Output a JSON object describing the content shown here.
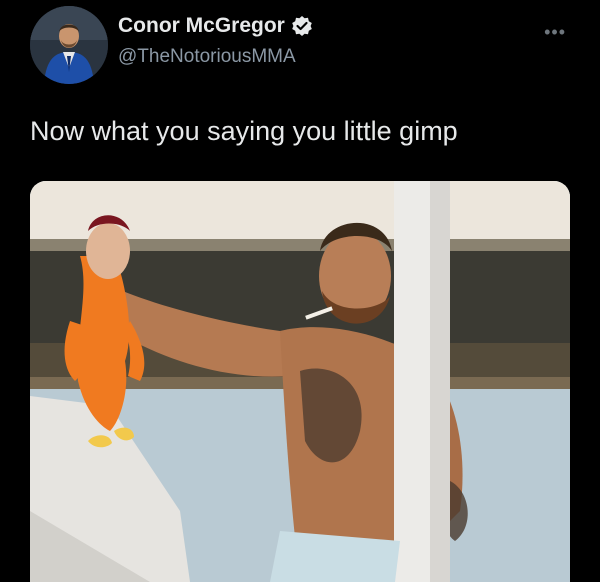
{
  "author": {
    "name": "Conor McGregor",
    "handle": "@TheNotoriousMMA",
    "verified": true
  },
  "tweet": {
    "text": "Now what you saying you little gimp"
  },
  "icons": {
    "verified": "verified-badge-icon",
    "more": "more-options-icon"
  },
  "colors": {
    "background": "#000000",
    "text": "#e7e9ea",
    "handle": "#8b98a5"
  }
}
